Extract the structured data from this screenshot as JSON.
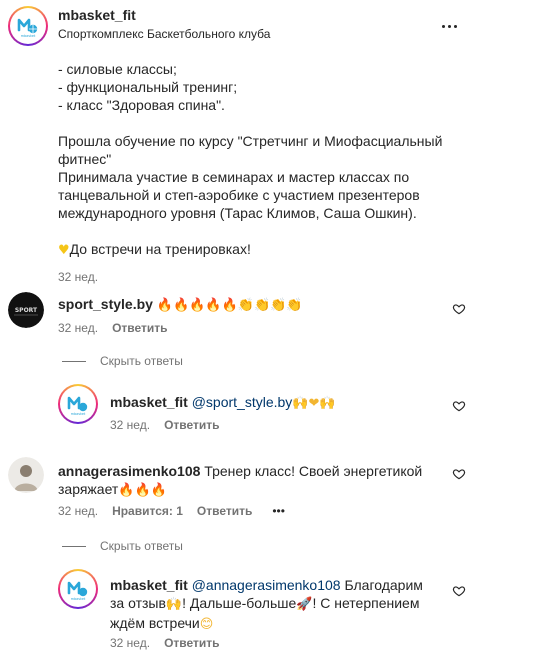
{
  "post": {
    "username": "mbasket_fit",
    "subtitle": "Спорткомплекс Баскетбольного клуба",
    "avatar_icon": "mbasket-logo-icon"
  },
  "caption": {
    "lines": [
      "- силовые классы;",
      "- функциональный тренинг;",
      "- класс \"Здоровая спина\".",
      "",
      "Прошла обучение по курсу \"Стретчинг и Миофасциальный фитнес\"",
      "Принимала участие в семинарах и мастер классах по танцевальной и степ-аэробике с участием презентеров международного уровня (Тарас Климов, Саша Ошкин).",
      ""
    ],
    "closing_emoji": "♥",
    "closing_text": "До встречи на тренировках!",
    "time": "32 нед."
  },
  "comments": [
    {
      "username": "sport_style.by",
      "text": "",
      "emojis": "🔥🔥🔥🔥🔥👏👏👏👏",
      "time": "32 нед.",
      "reply_label": "Ответить",
      "hide_replies": "Скрыть ответы",
      "reply": {
        "username": "mbasket_fit",
        "mention": "@sport_style.by",
        "text_after": " 🙌❤🙌",
        "time": "32 нед.",
        "reply_label": "Ответить"
      }
    },
    {
      "username": "annagerasimenko108",
      "text": "Тренер класс! Своей энергетикой заряжает",
      "emojis": "🔥🔥🔥",
      "time": "32 нед.",
      "likes_label": "Нравится: 1",
      "reply_label": "Ответить",
      "more": "•••",
      "hide_replies": "Скрыть ответы",
      "reply": {
        "username": "mbasket_fit",
        "mention": "@annagerasimenko108",
        "text_1": " Благодарим за отзыв",
        "emoji_1": "🙌",
        "text_2": "! Дальше-больше",
        "emoji_2": "🚀",
        "text_3": "! С нетерпением ждём встречи",
        "emoji_3": "😊",
        "time": "32 нед.",
        "reply_label": "Ответить"
      }
    }
  ],
  "colors": {
    "link": "#00376b",
    "meta": "#737373",
    "text": "#262626"
  }
}
